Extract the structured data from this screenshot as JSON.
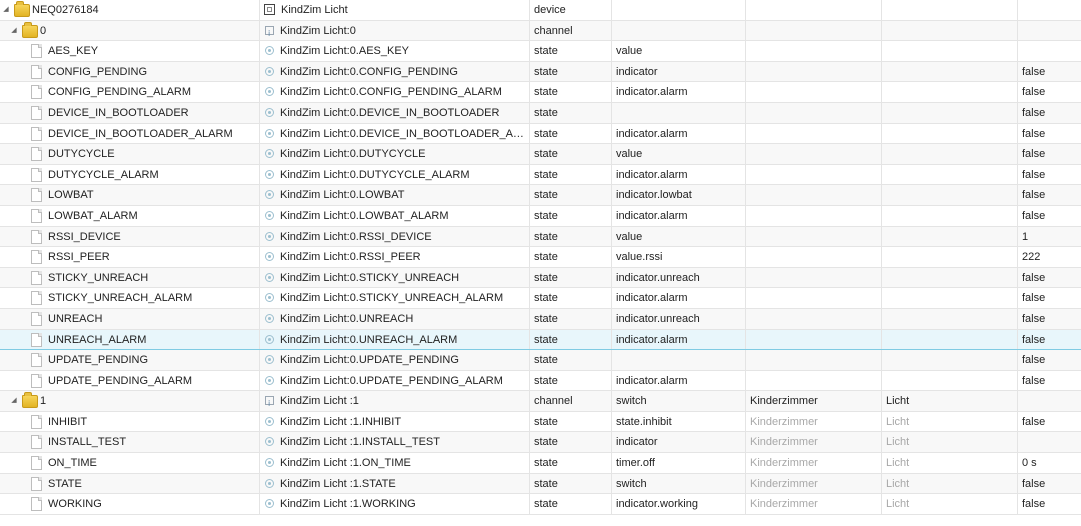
{
  "rows": [
    {
      "level": 0,
      "kind": "folder",
      "expanded": true,
      "id": "NEQ0276184",
      "name_icon": "device",
      "name": "KindZim Licht",
      "type": "device",
      "role": "",
      "room": "",
      "function": "",
      "value": ""
    },
    {
      "level": 1,
      "kind": "folder",
      "expanded": true,
      "id": "0",
      "name_icon": "channel",
      "name": "KindZim Licht:0",
      "type": "channel",
      "role": "",
      "room": "",
      "function": "",
      "value": ""
    },
    {
      "level": 2,
      "kind": "doc",
      "id": "AES_KEY",
      "name_icon": "state",
      "name": "KindZim Licht:0.AES_KEY",
      "type": "state",
      "role": "value",
      "room": "",
      "function": "",
      "value": ""
    },
    {
      "level": 2,
      "kind": "doc",
      "id": "CONFIG_PENDING",
      "name_icon": "state",
      "name": "KindZim Licht:0.CONFIG_PENDING",
      "type": "state",
      "role": "indicator",
      "room": "",
      "function": "",
      "value": "false"
    },
    {
      "level": 2,
      "kind": "doc",
      "id": "CONFIG_PENDING_ALARM",
      "name_icon": "state",
      "name": "KindZim Licht:0.CONFIG_PENDING_ALARM",
      "type": "state",
      "role": "indicator.alarm",
      "room": "",
      "function": "",
      "value": "false"
    },
    {
      "level": 2,
      "kind": "doc",
      "id": "DEVICE_IN_BOOTLOADER",
      "name_icon": "state",
      "name": "KindZim Licht:0.DEVICE_IN_BOOTLOADER",
      "type": "state",
      "role": "",
      "room": "",
      "function": "",
      "value": "false"
    },
    {
      "level": 2,
      "kind": "doc",
      "id": "DEVICE_IN_BOOTLOADER_ALARM",
      "name_icon": "state",
      "name": "KindZim Licht:0.DEVICE_IN_BOOTLOADER_ALA...",
      "type": "state",
      "role": "indicator.alarm",
      "room": "",
      "function": "",
      "value": "false"
    },
    {
      "level": 2,
      "kind": "doc",
      "id": "DUTYCYCLE",
      "name_icon": "state",
      "name": "KindZim Licht:0.DUTYCYCLE",
      "type": "state",
      "role": "value",
      "room": "",
      "function": "",
      "value": "false"
    },
    {
      "level": 2,
      "kind": "doc",
      "id": "DUTYCYCLE_ALARM",
      "name_icon": "state",
      "name": "KindZim Licht:0.DUTYCYCLE_ALARM",
      "type": "state",
      "role": "indicator.alarm",
      "room": "",
      "function": "",
      "value": "false"
    },
    {
      "level": 2,
      "kind": "doc",
      "id": "LOWBAT",
      "name_icon": "state",
      "name": "KindZim Licht:0.LOWBAT",
      "type": "state",
      "role": "indicator.lowbat",
      "room": "",
      "function": "",
      "value": "false"
    },
    {
      "level": 2,
      "kind": "doc",
      "id": "LOWBAT_ALARM",
      "name_icon": "state",
      "name": "KindZim Licht:0.LOWBAT_ALARM",
      "type": "state",
      "role": "indicator.alarm",
      "room": "",
      "function": "",
      "value": "false"
    },
    {
      "level": 2,
      "kind": "doc",
      "id": "RSSI_DEVICE",
      "name_icon": "state",
      "name": "KindZim Licht:0.RSSI_DEVICE",
      "type": "state",
      "role": "value",
      "room": "",
      "function": "",
      "value": "1"
    },
    {
      "level": 2,
      "kind": "doc",
      "id": "RSSI_PEER",
      "name_icon": "state",
      "name": "KindZim Licht:0.RSSI_PEER",
      "type": "state",
      "role": "value.rssi",
      "room": "",
      "function": "",
      "value": "222"
    },
    {
      "level": 2,
      "kind": "doc",
      "id": "STICKY_UNREACH",
      "name_icon": "state",
      "name": "KindZim Licht:0.STICKY_UNREACH",
      "type": "state",
      "role": "indicator.unreach",
      "room": "",
      "function": "",
      "value": "false"
    },
    {
      "level": 2,
      "kind": "doc",
      "id": "STICKY_UNREACH_ALARM",
      "name_icon": "state",
      "name": "KindZim Licht:0.STICKY_UNREACH_ALARM",
      "type": "state",
      "role": "indicator.alarm",
      "room": "",
      "function": "",
      "value": "false"
    },
    {
      "level": 2,
      "kind": "doc",
      "id": "UNREACH",
      "name_icon": "state",
      "name": "KindZim Licht:0.UNREACH",
      "type": "state",
      "role": "indicator.unreach",
      "room": "",
      "function": "",
      "value": "false"
    },
    {
      "level": 2,
      "kind": "doc",
      "id": "UNREACH_ALARM",
      "name_icon": "state",
      "name": "KindZim Licht:0.UNREACH_ALARM",
      "type": "state",
      "role": "indicator.alarm",
      "room": "",
      "function": "",
      "value": "false",
      "selected": true
    },
    {
      "level": 2,
      "kind": "doc",
      "id": "UPDATE_PENDING",
      "name_icon": "state",
      "name": "KindZim Licht:0.UPDATE_PENDING",
      "type": "state",
      "role": "",
      "room": "",
      "function": "",
      "value": "false"
    },
    {
      "level": 2,
      "kind": "doc",
      "id": "UPDATE_PENDING_ALARM",
      "name_icon": "state",
      "name": "KindZim Licht:0.UPDATE_PENDING_ALARM",
      "type": "state",
      "role": "indicator.alarm",
      "room": "",
      "function": "",
      "value": "false"
    },
    {
      "level": 1,
      "kind": "folder",
      "expanded": true,
      "id": "1",
      "name_icon": "channel",
      "name": "KindZim Licht :1",
      "type": "channel",
      "role": "switch",
      "room": "Kinderzimmer",
      "function": "Licht",
      "value": ""
    },
    {
      "level": 2,
      "kind": "doc",
      "id": "INHIBIT",
      "name_icon": "state",
      "name": "KindZim Licht :1.INHIBIT",
      "type": "state",
      "role": "state.inhibit",
      "room": "Kinderzimmer",
      "function": "Licht",
      "value": "false",
      "inherited": true
    },
    {
      "level": 2,
      "kind": "doc",
      "id": "INSTALL_TEST",
      "name_icon": "state",
      "name": "KindZim Licht :1.INSTALL_TEST",
      "type": "state",
      "role": "indicator",
      "room": "Kinderzimmer",
      "function": "Licht",
      "value": "",
      "inherited": true
    },
    {
      "level": 2,
      "kind": "doc",
      "id": "ON_TIME",
      "name_icon": "state",
      "name": "KindZim Licht :1.ON_TIME",
      "type": "state",
      "role": "timer.off",
      "room": "Kinderzimmer",
      "function": "Licht",
      "value": "0 s",
      "inherited": true
    },
    {
      "level": 2,
      "kind": "doc",
      "id": "STATE",
      "name_icon": "state",
      "name": "KindZim Licht :1.STATE",
      "type": "state",
      "role": "switch",
      "room": "Kinderzimmer",
      "function": "Licht",
      "value": "false",
      "inherited": true
    },
    {
      "level": 2,
      "kind": "doc",
      "id": "WORKING",
      "name_icon": "state",
      "name": "KindZim Licht :1.WORKING",
      "type": "state",
      "role": "indicator.working",
      "room": "Kinderzimmer",
      "function": "Licht",
      "value": "false",
      "inherited": true
    }
  ]
}
